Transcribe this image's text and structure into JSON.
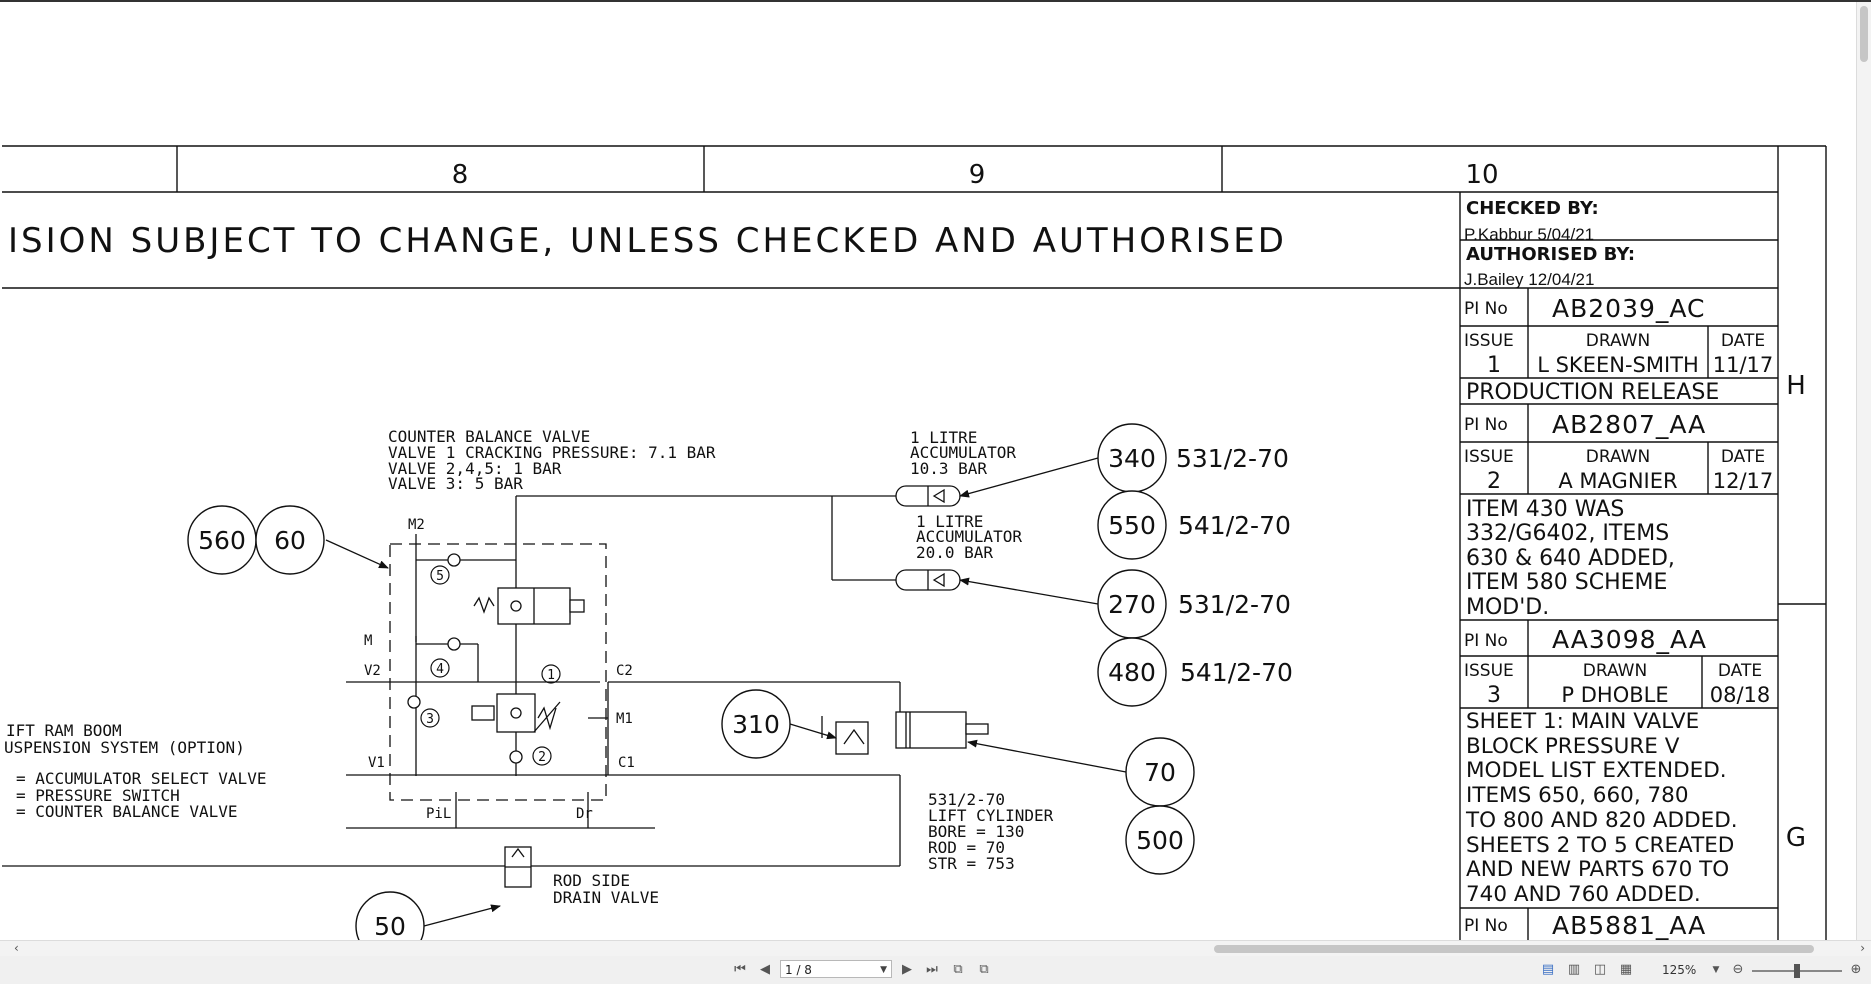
{
  "viewer": {
    "zoom": "125%",
    "page_indicator": "1 / 8"
  },
  "sheet": {
    "columns": [
      "8",
      "9",
      "10"
    ],
    "row_letters": [
      "H",
      "G"
    ],
    "banner": "ISION SUBJECT TO CHANGE, UNLESS CHECKED AND AUTHORISED"
  },
  "title_block": {
    "checked_label": "CHECKED BY:",
    "checked_sig": "P.Kabbur 5/04/21",
    "authorised_label": "AUTHORISED BY:",
    "authorised_sig": "J.Bailey 12/04/21",
    "revisions": [
      {
        "pi_label": "PI No",
        "pi": "AB2039_AC",
        "issue_label": "ISSUE",
        "issue": "1",
        "drawn_label": "DRAWN",
        "drawn": "L SKEEN-SMITH",
        "date_label": "DATE",
        "date": "11/17",
        "notes": [
          "PRODUCTION RELEASE"
        ]
      },
      {
        "pi_label": "PI No",
        "pi": "AB2807_AA",
        "issue_label": "ISSUE",
        "issue": "2",
        "drawn_label": "DRAWN",
        "drawn": "A MAGNIER",
        "date_label": "DATE",
        "date": "12/17",
        "notes": [
          "ITEM 430 WAS",
          "332/G6402, ITEMS",
          "630 & 640 ADDED,",
          "ITEM 580 SCHEME",
          "MOD'D."
        ]
      },
      {
        "pi_label": "PI No",
        "pi": "AA3098_AA",
        "issue_label": "ISSUE",
        "issue": "3",
        "drawn_label": "DRAWN",
        "drawn": "P DHOBLE",
        "date_label": "DATE",
        "date": "08/18",
        "notes": [
          "SHEET 1: MAIN VALVE",
          "BLOCK PRESSURE V",
          "MODEL LIST EXTENDED.",
          "ITEMS 650, 660, 780",
          "TO 800 AND 820 ADDED.",
          "SHEETS 2 TO 5 CREATED",
          "AND NEW PARTS 670 TO",
          "740 AND 760 ADDED."
        ]
      },
      {
        "pi_label": "PI No",
        "pi": "AB5881_AA"
      }
    ]
  },
  "schematic": {
    "cbv_note": [
      "COUNTER BALANCE VALVE",
      "VALVE 1 CRACKING PRESSURE: 7.1 BAR",
      "VALVE 2,4,5: 1 BAR",
      "VALVE 3: 5 BAR"
    ],
    "acc1_note": [
      "1 LITRE",
      "ACCUMULATOR",
      "10.3 BAR"
    ],
    "acc2_note": [
      "1 LITRE",
      "ACCUMULATOR",
      "20.0 BAR"
    ],
    "boom_note": [
      "IFT RAM BOOM",
      "USPENSION SYSTEM (OPTION)"
    ],
    "legend": [
      "= ACCUMULATOR SELECT VALVE",
      "= PRESSURE SWITCH",
      "= COUNTER BALANCE VALVE"
    ],
    "cylinder_note": [
      "531/2-70",
      "LIFT CYLINDER",
      "BORE = 130",
      "ROD  =  70",
      "STR  = 753"
    ],
    "drain_note": [
      "ROD SIDE",
      "DRAIN VALVE"
    ],
    "ports": {
      "m2": "M2",
      "m": "M",
      "v2": "V2",
      "v1": "V1",
      "c2": "C2",
      "c1": "C1",
      "m1": "M1",
      "pil": "PiL",
      "dr": "Dr"
    },
    "valve_numbers": [
      "1",
      "2",
      "3",
      "4",
      "5"
    ],
    "balloons": {
      "b560": "560",
      "b60": "60",
      "b340": "340",
      "b550": "550",
      "b270": "270",
      "b480": "480",
      "b310": "310",
      "b70": "70",
      "b500": "500",
      "b50": "50"
    },
    "refs": {
      "r340": "531/2-70",
      "r550": "541/2-70",
      "r270": "531/2-70",
      "r480": "541/2-70"
    }
  }
}
